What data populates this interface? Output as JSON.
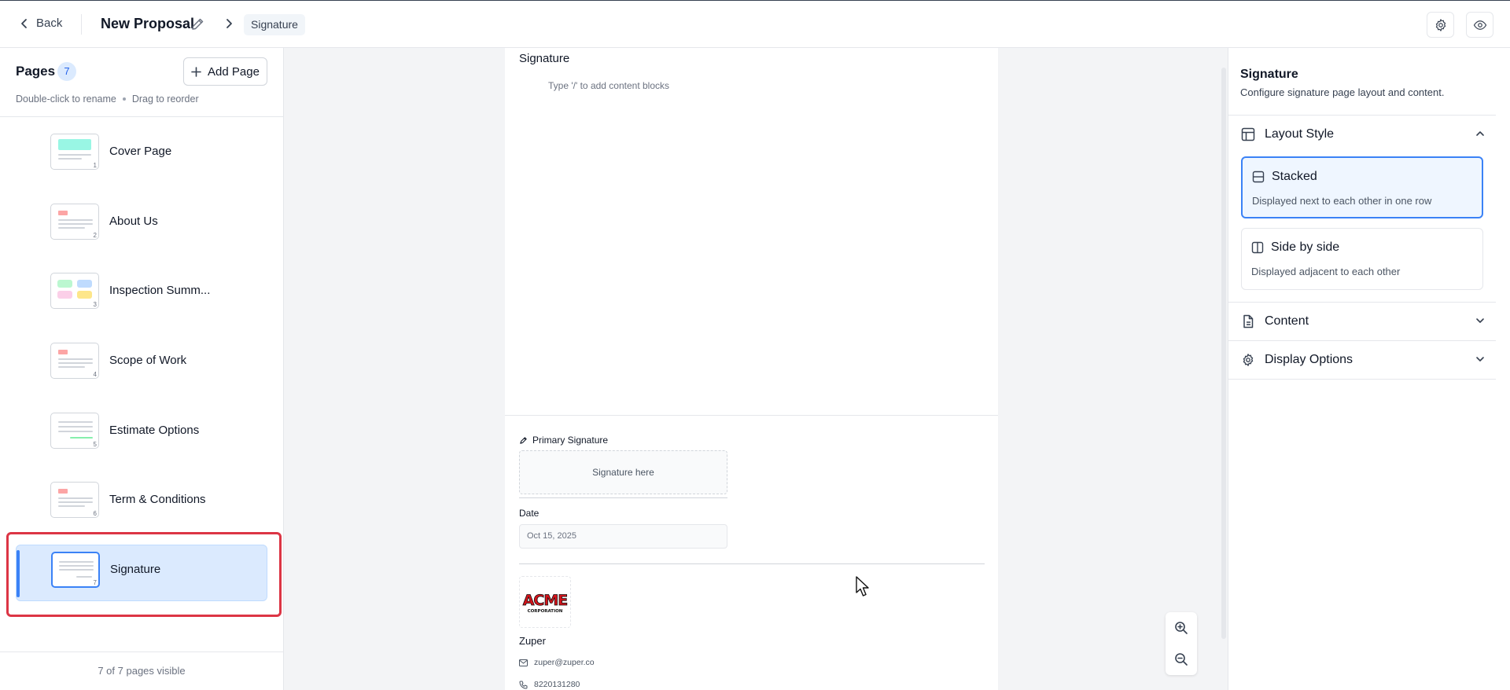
{
  "header": {
    "back_label": "Back",
    "title": "New Proposal",
    "breadcrumb": "Signature"
  },
  "sidebar": {
    "title": "Pages",
    "count": "7",
    "add_label": "Add Page",
    "hint_rename": "Double-click to rename",
    "hint_reorder": "Drag to reorder",
    "footer": "7 of 7 pages visible",
    "pages": [
      {
        "label": "Cover Page",
        "num": "1"
      },
      {
        "label": "About Us",
        "num": "2"
      },
      {
        "label": "Inspection Summ...",
        "num": "3"
      },
      {
        "label": "Scope of Work",
        "num": "4"
      },
      {
        "label": "Estimate Options",
        "num": "5"
      },
      {
        "label": "Term & Conditions",
        "num": "6"
      },
      {
        "label": "Signature",
        "num": "7"
      }
    ]
  },
  "canvas": {
    "section_title": "Signature",
    "placeholder": "Type '/' to add content blocks",
    "primary_signature_label": "Primary Signature",
    "signature_placeholder": "Signature here",
    "date_label": "Date",
    "date_value": "Oct 15, 2025",
    "company_name": "Zuper",
    "email": "zuper@zuper.co",
    "phone": "8220131280",
    "logo_text": "ACME",
    "logo_subtext": "CORPORATION"
  },
  "panel": {
    "title": "Signature",
    "subtitle": "Configure signature page layout and content.",
    "layout_label": "Layout Style",
    "options": [
      {
        "title": "Stacked",
        "desc": "Displayed next to each other in one row"
      },
      {
        "title": "Side by side",
        "desc": "Displayed adjacent to each other"
      }
    ],
    "content_label": "Content",
    "display_label": "Display Options"
  },
  "colors": {
    "accent": "#3b82f6",
    "highlight": "#dc3545",
    "logo_red": "#d6141b"
  }
}
